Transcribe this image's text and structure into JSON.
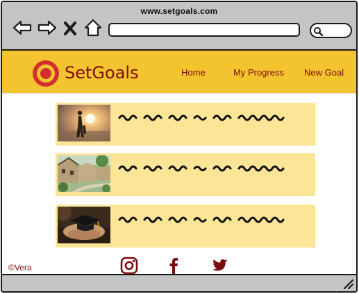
{
  "browser": {
    "url": "www.setgoals.com",
    "icons": [
      "back-arrow-icon",
      "forward-arrow-icon",
      "close-icon",
      "home-icon",
      "search-icon"
    ]
  },
  "app": {
    "name": "SetGoals",
    "brand_color": "#7a0d0d",
    "header_color": "#f4c430",
    "card_color": "#fde597",
    "nav": [
      {
        "label": "Home"
      },
      {
        "label": "My Progress"
      },
      {
        "label": "New Goal"
      }
    ]
  },
  "feed": {
    "items": [
      {
        "image": "silhouette-at-sunset-photo"
      },
      {
        "image": "cottage-village-lane-photo"
      },
      {
        "image": "graduation-cap-on-hands-photo"
      }
    ]
  },
  "footer": {
    "copyright": "©Vera",
    "social": [
      "instagram-icon",
      "facebook-icon",
      "twitter-icon"
    ]
  }
}
